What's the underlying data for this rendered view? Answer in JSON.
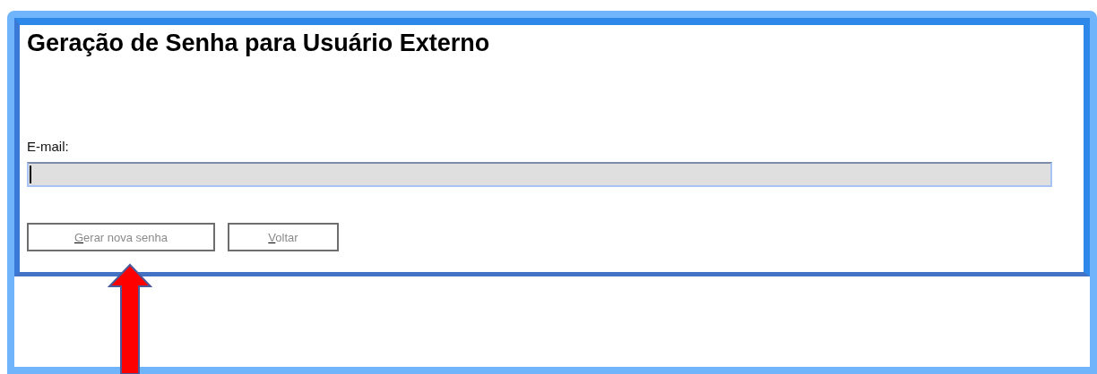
{
  "page": {
    "title": "Geração de Senha para Usuário Externo"
  },
  "email_field": {
    "label": "E-mail:",
    "focused": true
  },
  "buttons": [
    {
      "label": "Gerar nova senha",
      "access_key_underlined": true
    },
    {
      "label": "Voltar",
      "access_key_underlined": true
    }
  ],
  "annotation": {
    "kind": "arrow"
  }
}
